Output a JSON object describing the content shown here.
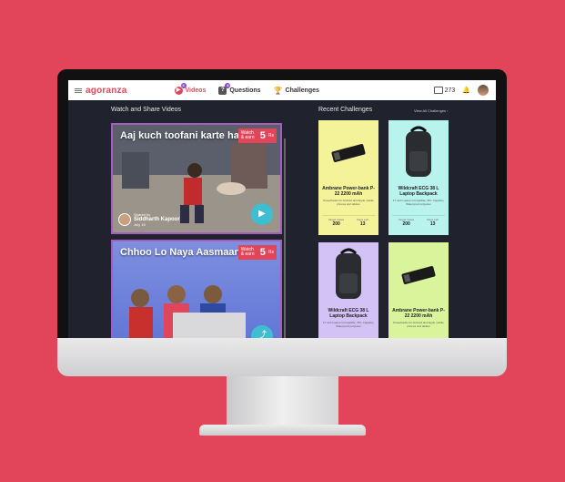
{
  "topbar": {
    "logo": "agoranza",
    "nav": [
      {
        "label": "Videos",
        "badge": "4",
        "active": true
      },
      {
        "label": "Questions",
        "badge": "4",
        "active": false
      },
      {
        "label": "Challenges",
        "active": false
      }
    ],
    "count": "273"
  },
  "main": {
    "videos_heading": "Watch and Share Videos",
    "challenges_heading": "Recent Challenges",
    "view_all": "View All Challenges ›"
  },
  "videos": [
    {
      "title": "Aaj kuch toofani karte hai...",
      "earn_label": "Watch & earn",
      "earn_value": "5",
      "earn_unit": "Rs",
      "shared_by_label": "Shared by",
      "shared_by": "Siddharth Kapoor",
      "date": "July 15"
    },
    {
      "title": "Chhoo Lo Naya Aasmaan...",
      "earn_label": "Watch & earn",
      "earn_value": "5",
      "earn_unit": "Rs"
    }
  ],
  "challenges": [
    {
      "name": "Ambrane Power-bank P-22 2200 mAh",
      "desc": "Powerbanks for Android and Apple mobile phones and tablets",
      "target_label": "Target Views",
      "target": "200",
      "days_label": "Days Left",
      "days": "13",
      "bg": "#f4f39a"
    },
    {
      "name": "Wildcraft ECG 38 L Laptop Backpack",
      "desc": "17 inch Laptop Compatible, 38 L Capacity, Waterproof polyester",
      "target_label": "Target Views",
      "target": "200",
      "days_label": "Days Left",
      "days": "13",
      "bg": "#b9f3ee"
    },
    {
      "name": "Wildcraft ECG 38 L Laptop Backpack",
      "desc": "17 inch Laptop Compatible, 38 L Capacity, Waterproof polyester",
      "bg": "#d3c2f5"
    },
    {
      "name": "Ambrane Power-bank P-22 2200 mAh",
      "desc": "Powerbanks for Android and Apple mobile phones and tablets",
      "bg": "#d9f49a"
    }
  ],
  "colors": {
    "accent": "#e2455a",
    "background": "#e2455a",
    "teal": "#3dbfd1"
  }
}
